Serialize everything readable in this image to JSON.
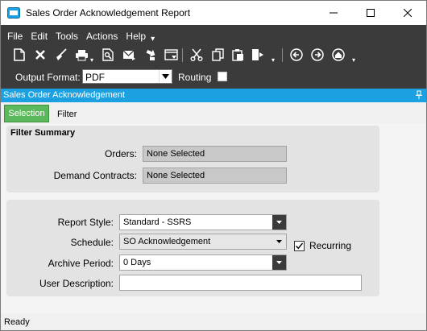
{
  "window": {
    "title": "Sales Order Acknowledgement Report",
    "controls": [
      "minimize",
      "maximize",
      "close"
    ]
  },
  "menu": {
    "items": [
      "File",
      "Edit",
      "Tools",
      "Actions",
      "Help"
    ]
  },
  "toolbar": {
    "icons": [
      "new-icon",
      "delete-icon",
      "clear-icon",
      "print-icon",
      "print-preview-icon",
      "email-icon",
      "attachment-icon",
      "options-icon",
      "cut-icon",
      "copy-icon",
      "paste-icon",
      "exit-icon",
      "back-icon",
      "forward-icon",
      "home-icon"
    ]
  },
  "output": {
    "format_label": "Output Format:",
    "format_value": "PDF",
    "routing_label": "Routing",
    "routing_checked": false
  },
  "panel": {
    "title": "Sales Order Acknowledgement",
    "header_color": "#1ba1e2"
  },
  "tabs": {
    "selected": "Selection",
    "other": "Filter",
    "selected_color": "#5cb85c"
  },
  "filter_summary": {
    "title": "Filter Summary",
    "orders_label": "Orders:",
    "orders_value": "None Selected",
    "contracts_label": "Demand Contracts:",
    "contracts_value": "None Selected"
  },
  "options": {
    "report_style_label": "Report Style:",
    "report_style_value": "Standard - SSRS",
    "schedule_label": "Schedule:",
    "schedule_value": "SO Acknowledgement",
    "recurring_label": "Recurring",
    "recurring_checked": true,
    "archive_label": "Archive Period:",
    "archive_value": "0 Days",
    "user_desc_label": "User Description:",
    "user_desc_value": ""
  },
  "status": {
    "text": "Ready"
  }
}
